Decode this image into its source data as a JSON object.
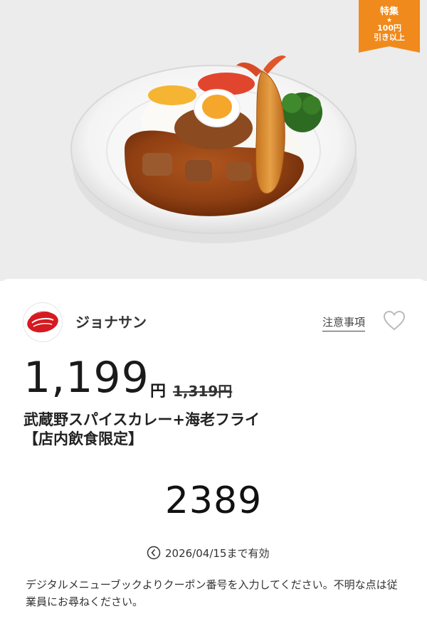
{
  "badge": {
    "line1": "特集",
    "star": "★",
    "line2": "100円",
    "line3": "引き以上"
  },
  "store": {
    "name": "ジョナサン",
    "logo_text": "ジョナサン"
  },
  "links": {
    "notice": "注意事項"
  },
  "price": {
    "current": "1,199",
    "yen": "円",
    "original": "1,319円"
  },
  "product": {
    "title_line1": "武蔵野スパイスカレー+海老フライ",
    "title_line2": "【店内飲食限定】"
  },
  "coupon": {
    "code": "2389",
    "expiry": "2026/04/15まで有効"
  },
  "instructions": "デジタルメニューブックよりクーポン番号を入力してください。不明な点は従業員にお尋ねください。",
  "colors": {
    "badge": "#f08a1c",
    "logo_red": "#d71920",
    "hero_bg": "#ececec"
  },
  "icons": {
    "heart": "heart-icon",
    "clock": "clock-icon"
  }
}
